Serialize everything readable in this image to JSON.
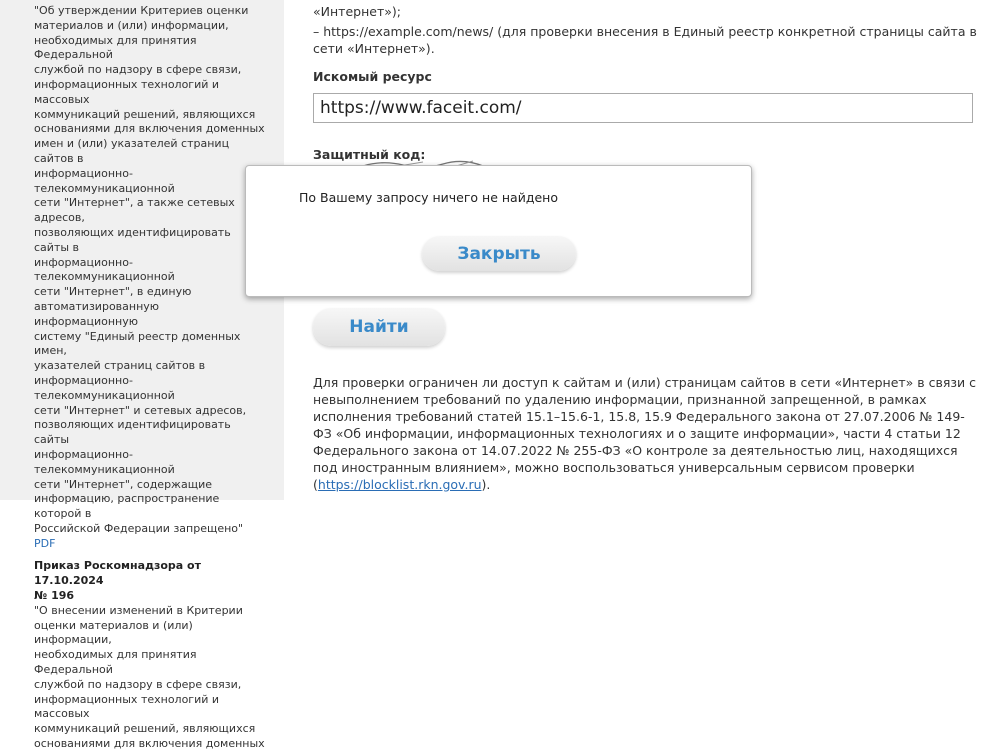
{
  "sidebar": {
    "doc1_text_lines": [
      "\"Об утверждении Критериев оценки",
      "материалов и (или) информации,",
      "необходимых для принятия Федеральной",
      "службой по надзору в сфере связи,",
      "информационных технологий и массовых",
      "коммуникаций решений, являющихся",
      "основаниями для включения доменных",
      "имен и (или) указателей страниц сайтов в",
      "информационно-телекоммуникационной",
      "сети \"Интернет\", а также сетевых адресов,",
      "позволяющих идентифицировать сайты в",
      "информационно-телекоммуникационной",
      "сети \"Интернет\", в единую",
      "автоматизированную информационную",
      "систему \"Единый реестр доменных имен,",
      "указателей страниц сайтов в",
      "информационно-телекоммуникационной",
      "сети \"Интернет\" и сетевых адресов,",
      "позволяющих идентифицировать сайты",
      "информационно-телекоммуникационной",
      "сети \"Интернет\", содержащие",
      "информацию, распространение которой в",
      "Российской Федерации запрещено\""
    ],
    "doc1_pdf_label": "PDF",
    "doc2_title_line1": "Приказ Роскомнадзора от 17.10.2024",
    "doc2_title_line2": "№ 196",
    "doc2_text_lines": [
      "\"О внесении изменений в Критерии",
      "оценки материалов и (или) информации,",
      "необходимых для принятия Федеральной",
      "службой по надзору в сфере связи,",
      "информационных технологий и массовых",
      "коммуникаций решений, являющихся",
      "основаниями для включения доменных"
    ]
  },
  "main": {
    "example_line1": "«Интернет»);",
    "example_line2": "– https://example.com/news/ (для проверки внесения в Единый реестр конкретной страницы сайта в",
    "example_line3": "сети «Интернет»).",
    "search_label": "Искомый ресурс",
    "search_value": "https://www.faceit.com/",
    "captcha_label": "Защитный код:",
    "find_label": "Найти",
    "info_text": "Для проверки ограничен ли доступ к сайтам и (или) страницам сайтов в сети «Интернет» в связи с невыполнением требований по удалению информации, признанной запрещенной, в рамках исполнения требований статей 15.1–15.6-1, 15.8, 15.9 Федерального закона от 27.07.2006 № 149-ФЗ «Об информации, информационных технологиях и о защите информации», части 4 статьи 12 Федерального закона от 14.07.2022 № 255-ФЗ «О контроле за деятельностью лиц, находящихся под иностранным влиянием», можно воспользоваться универсальным сервисом проверки (",
    "info_link": "https://blocklist.rkn.gov.ru",
    "info_tail": ")."
  },
  "modal": {
    "message": "По Вашему запросу ничего не найдено",
    "close_label": "Закрыть"
  },
  "colors": {
    "accent": "#3a8ac9",
    "link": "#2a6db5",
    "sidebar_bg": "#f0f0f0"
  }
}
